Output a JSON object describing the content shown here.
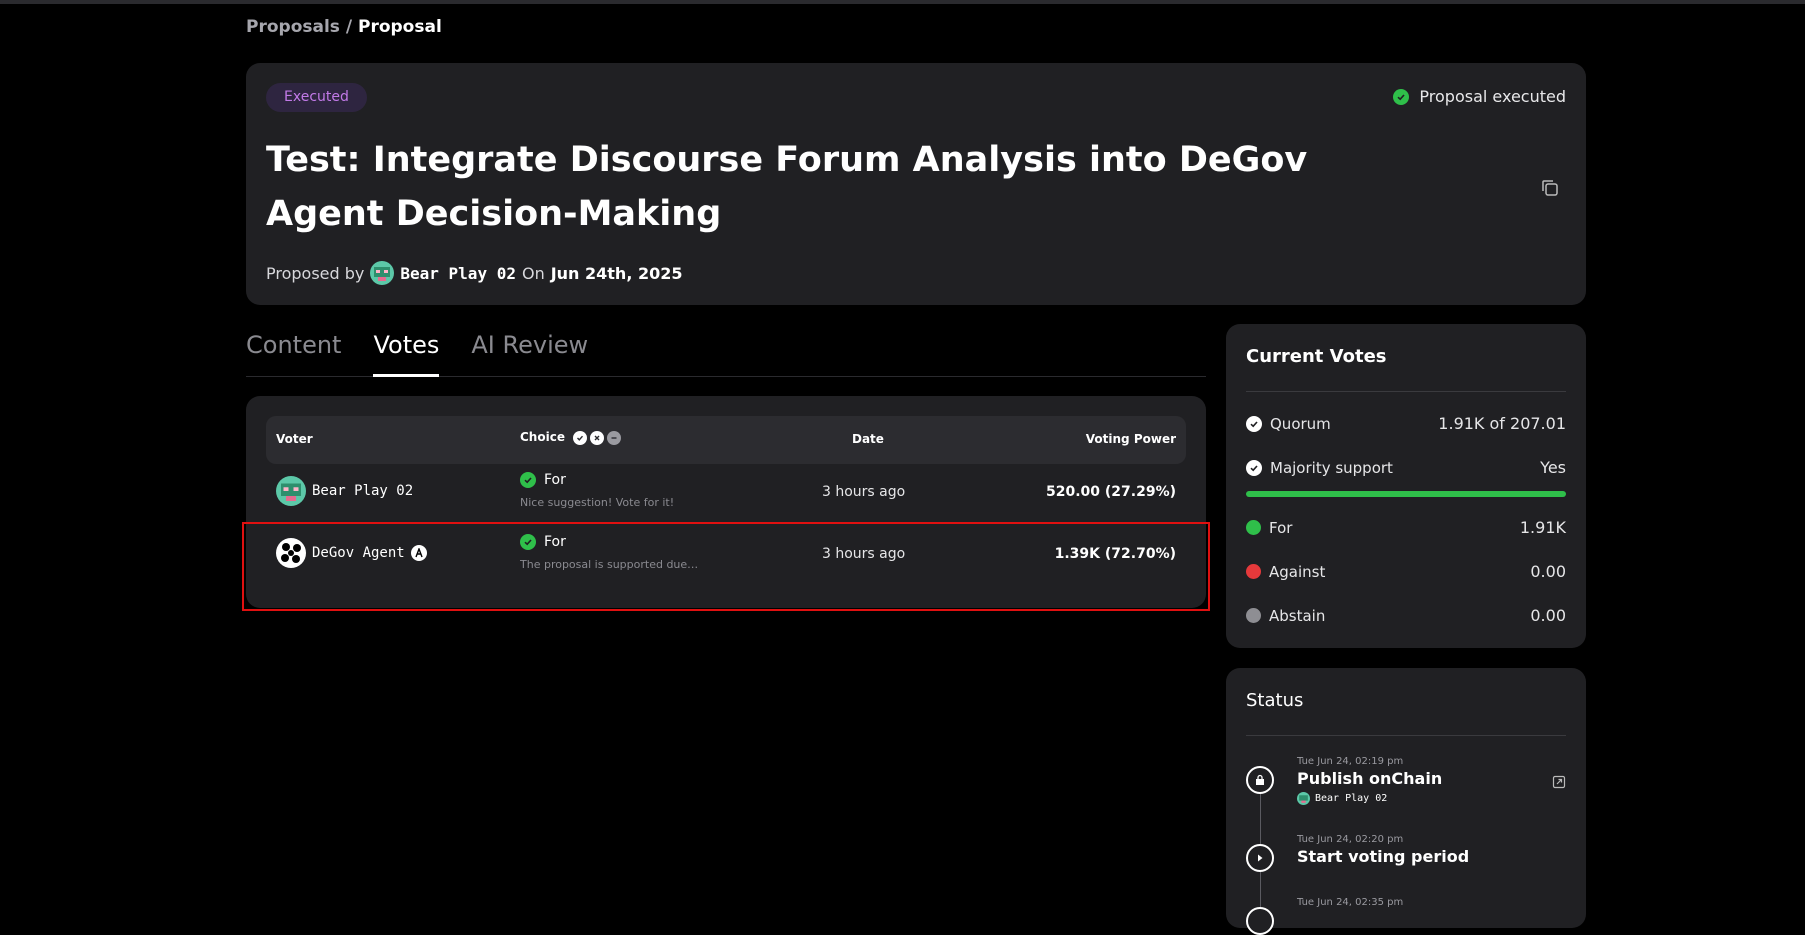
{
  "breadcrumb": {
    "parent": "Proposals",
    "separator": "/",
    "current": "Proposal"
  },
  "header": {
    "badge": "Executed",
    "status": "Proposal executed",
    "title": "Test: Integrate Discourse Forum Analysis into DeGov Agent Decision-Making",
    "proposed_by_label": "Proposed by",
    "proposer": "Bear Play 02",
    "on_label": "On",
    "date": "Jun 24th, 2025"
  },
  "tabs": [
    {
      "label": "Content",
      "active": false
    },
    {
      "label": "Votes",
      "active": true
    },
    {
      "label": "AI Review",
      "active": false
    }
  ],
  "votes_table": {
    "columns": {
      "voter": "Voter",
      "choice": "Choice",
      "date": "Date",
      "power": "Voting Power"
    },
    "rows": [
      {
        "voter": "Bear Play 02",
        "choice": "For",
        "reason": "Nice suggestion! Vote for it!",
        "date": "3 hours ago",
        "power": "520.00 (27.29%)"
      },
      {
        "voter": "DeGov Agent",
        "choice": "For",
        "reason": "The proposal is supported due ...",
        "date": "3 hours ago",
        "power": "1.39K (72.70%)"
      }
    ]
  },
  "current_votes": {
    "title": "Current Votes",
    "quorum_label": "Quorum",
    "quorum_value": "1.91K of 207.01",
    "majority_label": "Majority support",
    "majority_value": "Yes",
    "for_share": 1.0,
    "for_label": "For",
    "for_value": "1.91K",
    "against_label": "Against",
    "against_value": "0.00",
    "abstain_label": "Abstain",
    "abstain_value": "0.00"
  },
  "status_panel": {
    "title": "Status",
    "items": [
      {
        "time": "Tue Jun 24, 02:19 pm",
        "title": "Publish onChain",
        "by": "Bear Play 02"
      },
      {
        "time": "Tue Jun 24, 02:20 pm",
        "title": "Start voting period"
      },
      {
        "time": "Tue Jun 24, 02:35 pm"
      }
    ]
  },
  "colors": {
    "for": "#2fbf4a",
    "against": "#e5393b",
    "abstain": "#8e8e93",
    "badge_text": "#c27ae8",
    "highlight": "#e01010"
  }
}
